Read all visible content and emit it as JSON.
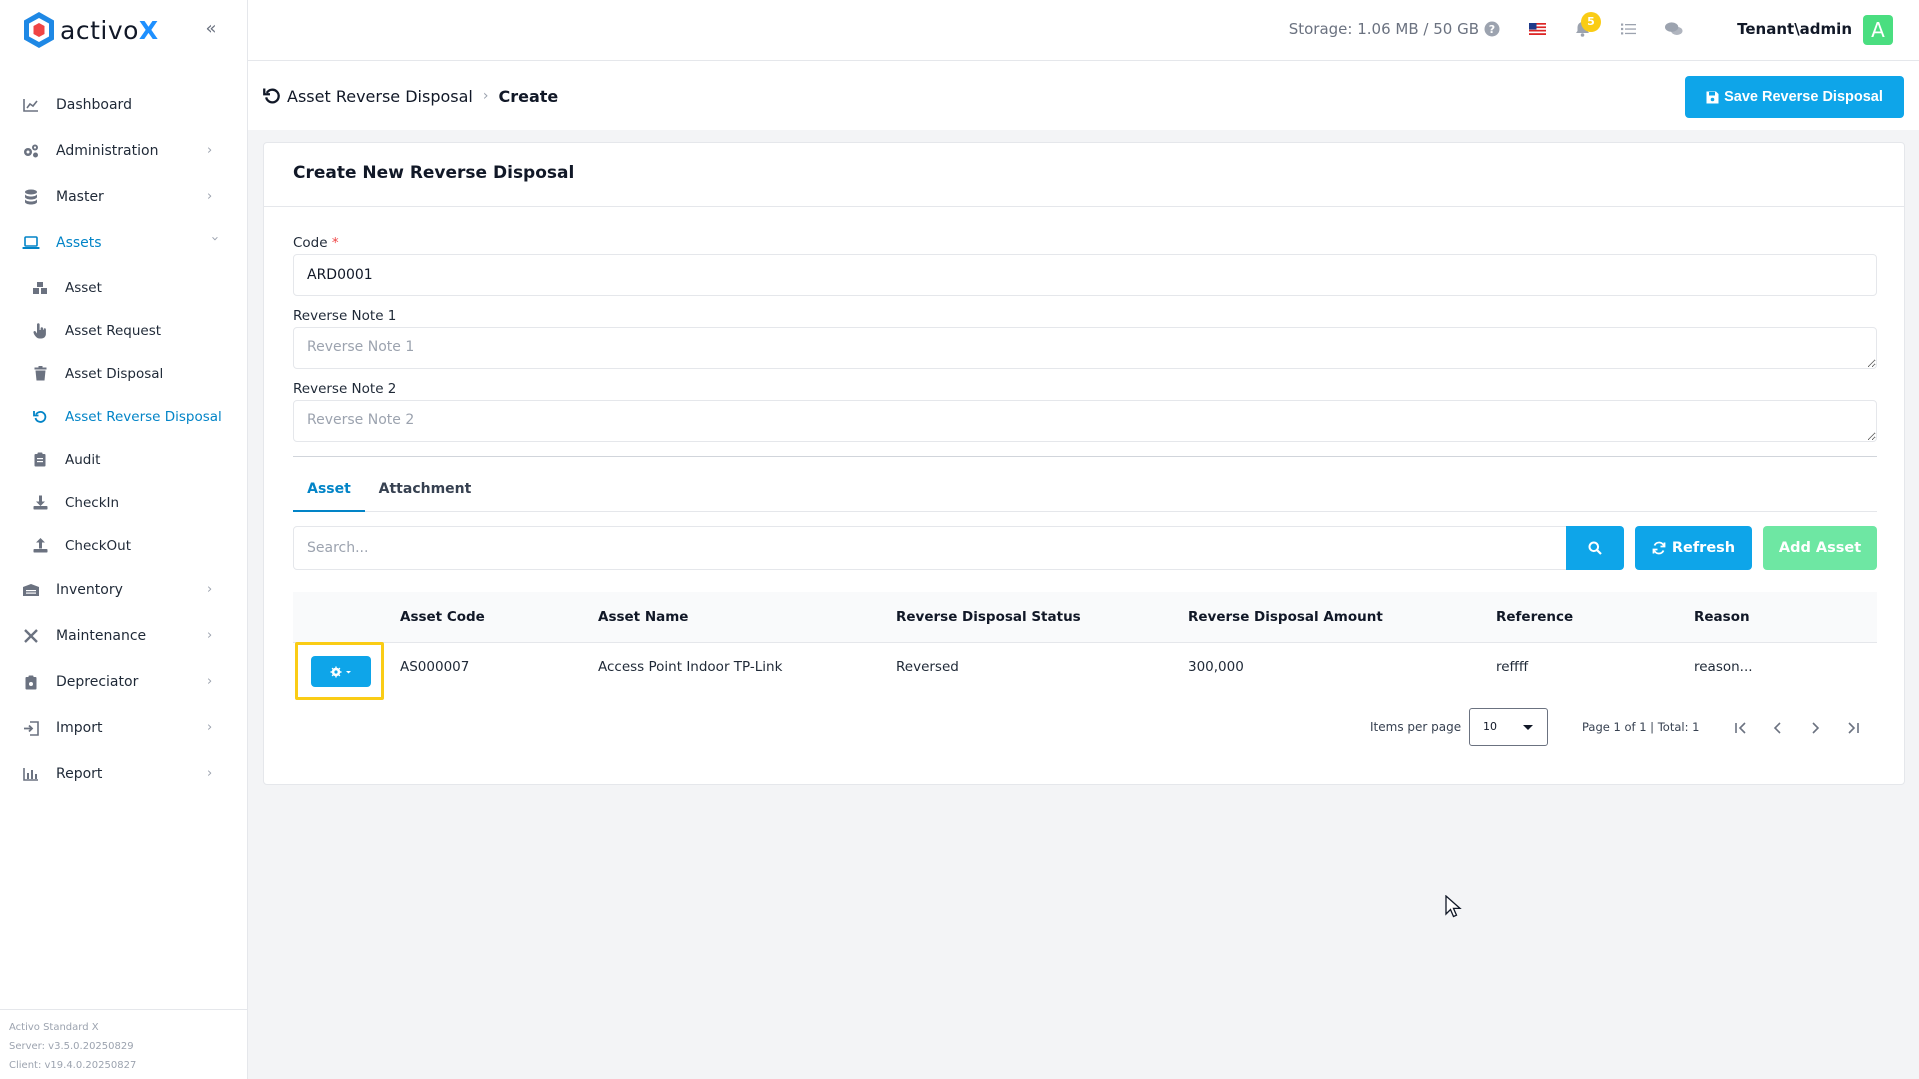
{
  "brand": {
    "name_prefix": "activo",
    "name_suffix": "X"
  },
  "sidebar": {
    "items": [
      {
        "label": "Dashboard",
        "icon": "chart-line-icon"
      },
      {
        "label": "Administration",
        "icon": "cogs-icon"
      },
      {
        "label": "Master",
        "icon": "database-icon"
      },
      {
        "label": "Assets",
        "icon": "laptop-icon"
      },
      {
        "label": "Inventory",
        "icon": "archive-icon"
      },
      {
        "label": "Maintenance",
        "icon": "tools-icon"
      },
      {
        "label": "Depreciator",
        "icon": "clipboard-icon"
      },
      {
        "label": "Import",
        "icon": "import-icon"
      },
      {
        "label": "Report",
        "icon": "bar-chart-icon"
      }
    ],
    "asset_sub_items": [
      {
        "label": "Asset"
      },
      {
        "label": "Asset Request"
      },
      {
        "label": "Asset Disposal"
      },
      {
        "label": "Asset Reverse Disposal"
      },
      {
        "label": "Audit"
      },
      {
        "label": "CheckIn"
      },
      {
        "label": "CheckOut"
      }
    ],
    "footer": {
      "product": "Activo Standard X",
      "server": "Server: v3.5.0.20250829",
      "client": "Client: v19.4.0.20250827"
    }
  },
  "topbar": {
    "storage": "Storage: 1.06 MB / 50 GB",
    "notification_count": "5",
    "user": "Tenant\\admin",
    "avatar_letter": "A"
  },
  "page": {
    "breadcrumb_parent": "Asset Reverse Disposal",
    "breadcrumb_current": "Create",
    "save_label": "Save Reverse Disposal"
  },
  "form": {
    "title": "Create New Reverse Disposal",
    "code_label": "Code",
    "code_required": "*",
    "code_value": "ARD0001",
    "note1_label": "Reverse Note 1",
    "note1_placeholder": "Reverse Note 1",
    "note2_label": "Reverse Note 2",
    "note2_placeholder": "Reverse Note 2"
  },
  "tabs": [
    {
      "label": "Asset",
      "active": true
    },
    {
      "label": "Attachment",
      "active": false
    }
  ],
  "toolbar": {
    "search_placeholder": "Search...",
    "refresh_label": "Refresh",
    "add_label": "Add Asset"
  },
  "table": {
    "headers": [
      "Asset Code",
      "Asset Name",
      "Reverse Disposal Status",
      "Reverse Disposal Amount",
      "Reference",
      "Reason"
    ],
    "rows": [
      [
        "AS000007",
        "Access Point Indoor TP-Link",
        "Reversed",
        "300,000",
        "reffff",
        "reason..."
      ]
    ]
  },
  "pager": {
    "items_per_page_label": "Items per page",
    "items_per_page": "10",
    "page_info": "Page 1 of 1 | Total: 1"
  },
  "colors": {
    "primary": "#0ea5e9",
    "active_nav": "#0284c7",
    "success": "#6ee7a3",
    "badge": "#facc15",
    "highlight": "#facc15"
  }
}
